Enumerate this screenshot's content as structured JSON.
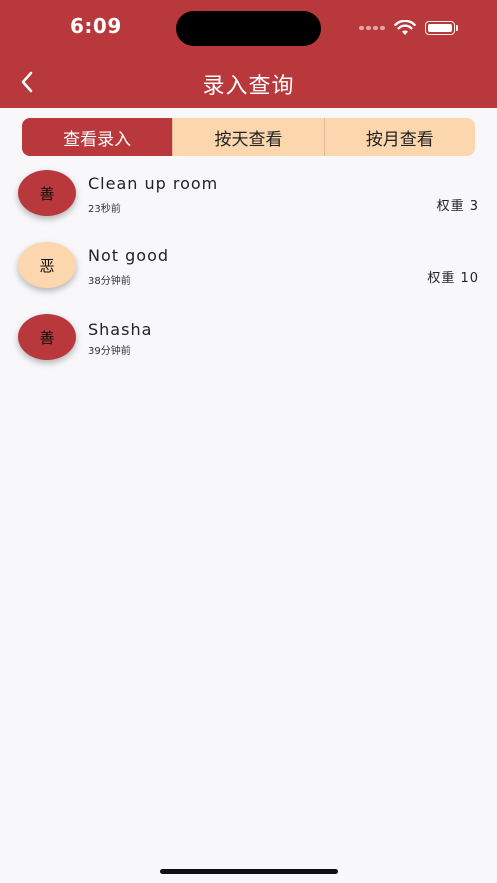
{
  "status_bar": {
    "time": "6:09"
  },
  "nav": {
    "title": "录入查询",
    "back_icon": "chevron-left-icon"
  },
  "tabs": [
    {
      "label": "查看录入",
      "active": true
    },
    {
      "label": "按天查看",
      "active": false
    },
    {
      "label": "按月查看",
      "active": false
    }
  ],
  "entries": [
    {
      "badge": "善",
      "type": "good",
      "title": "Clean up room",
      "time": "23秒前",
      "weight": "权重 3"
    },
    {
      "badge": "恶",
      "type": "bad",
      "title": "Not good",
      "time": "38分钟前",
      "weight": "权重 10"
    },
    {
      "badge": "善",
      "type": "good",
      "title": "Shasha",
      "time": "39分钟前",
      "weight": ""
    }
  ],
  "colors": {
    "primary": "#b8383b",
    "secondary": "#fcd6ac",
    "background": "#f8f8fb"
  }
}
